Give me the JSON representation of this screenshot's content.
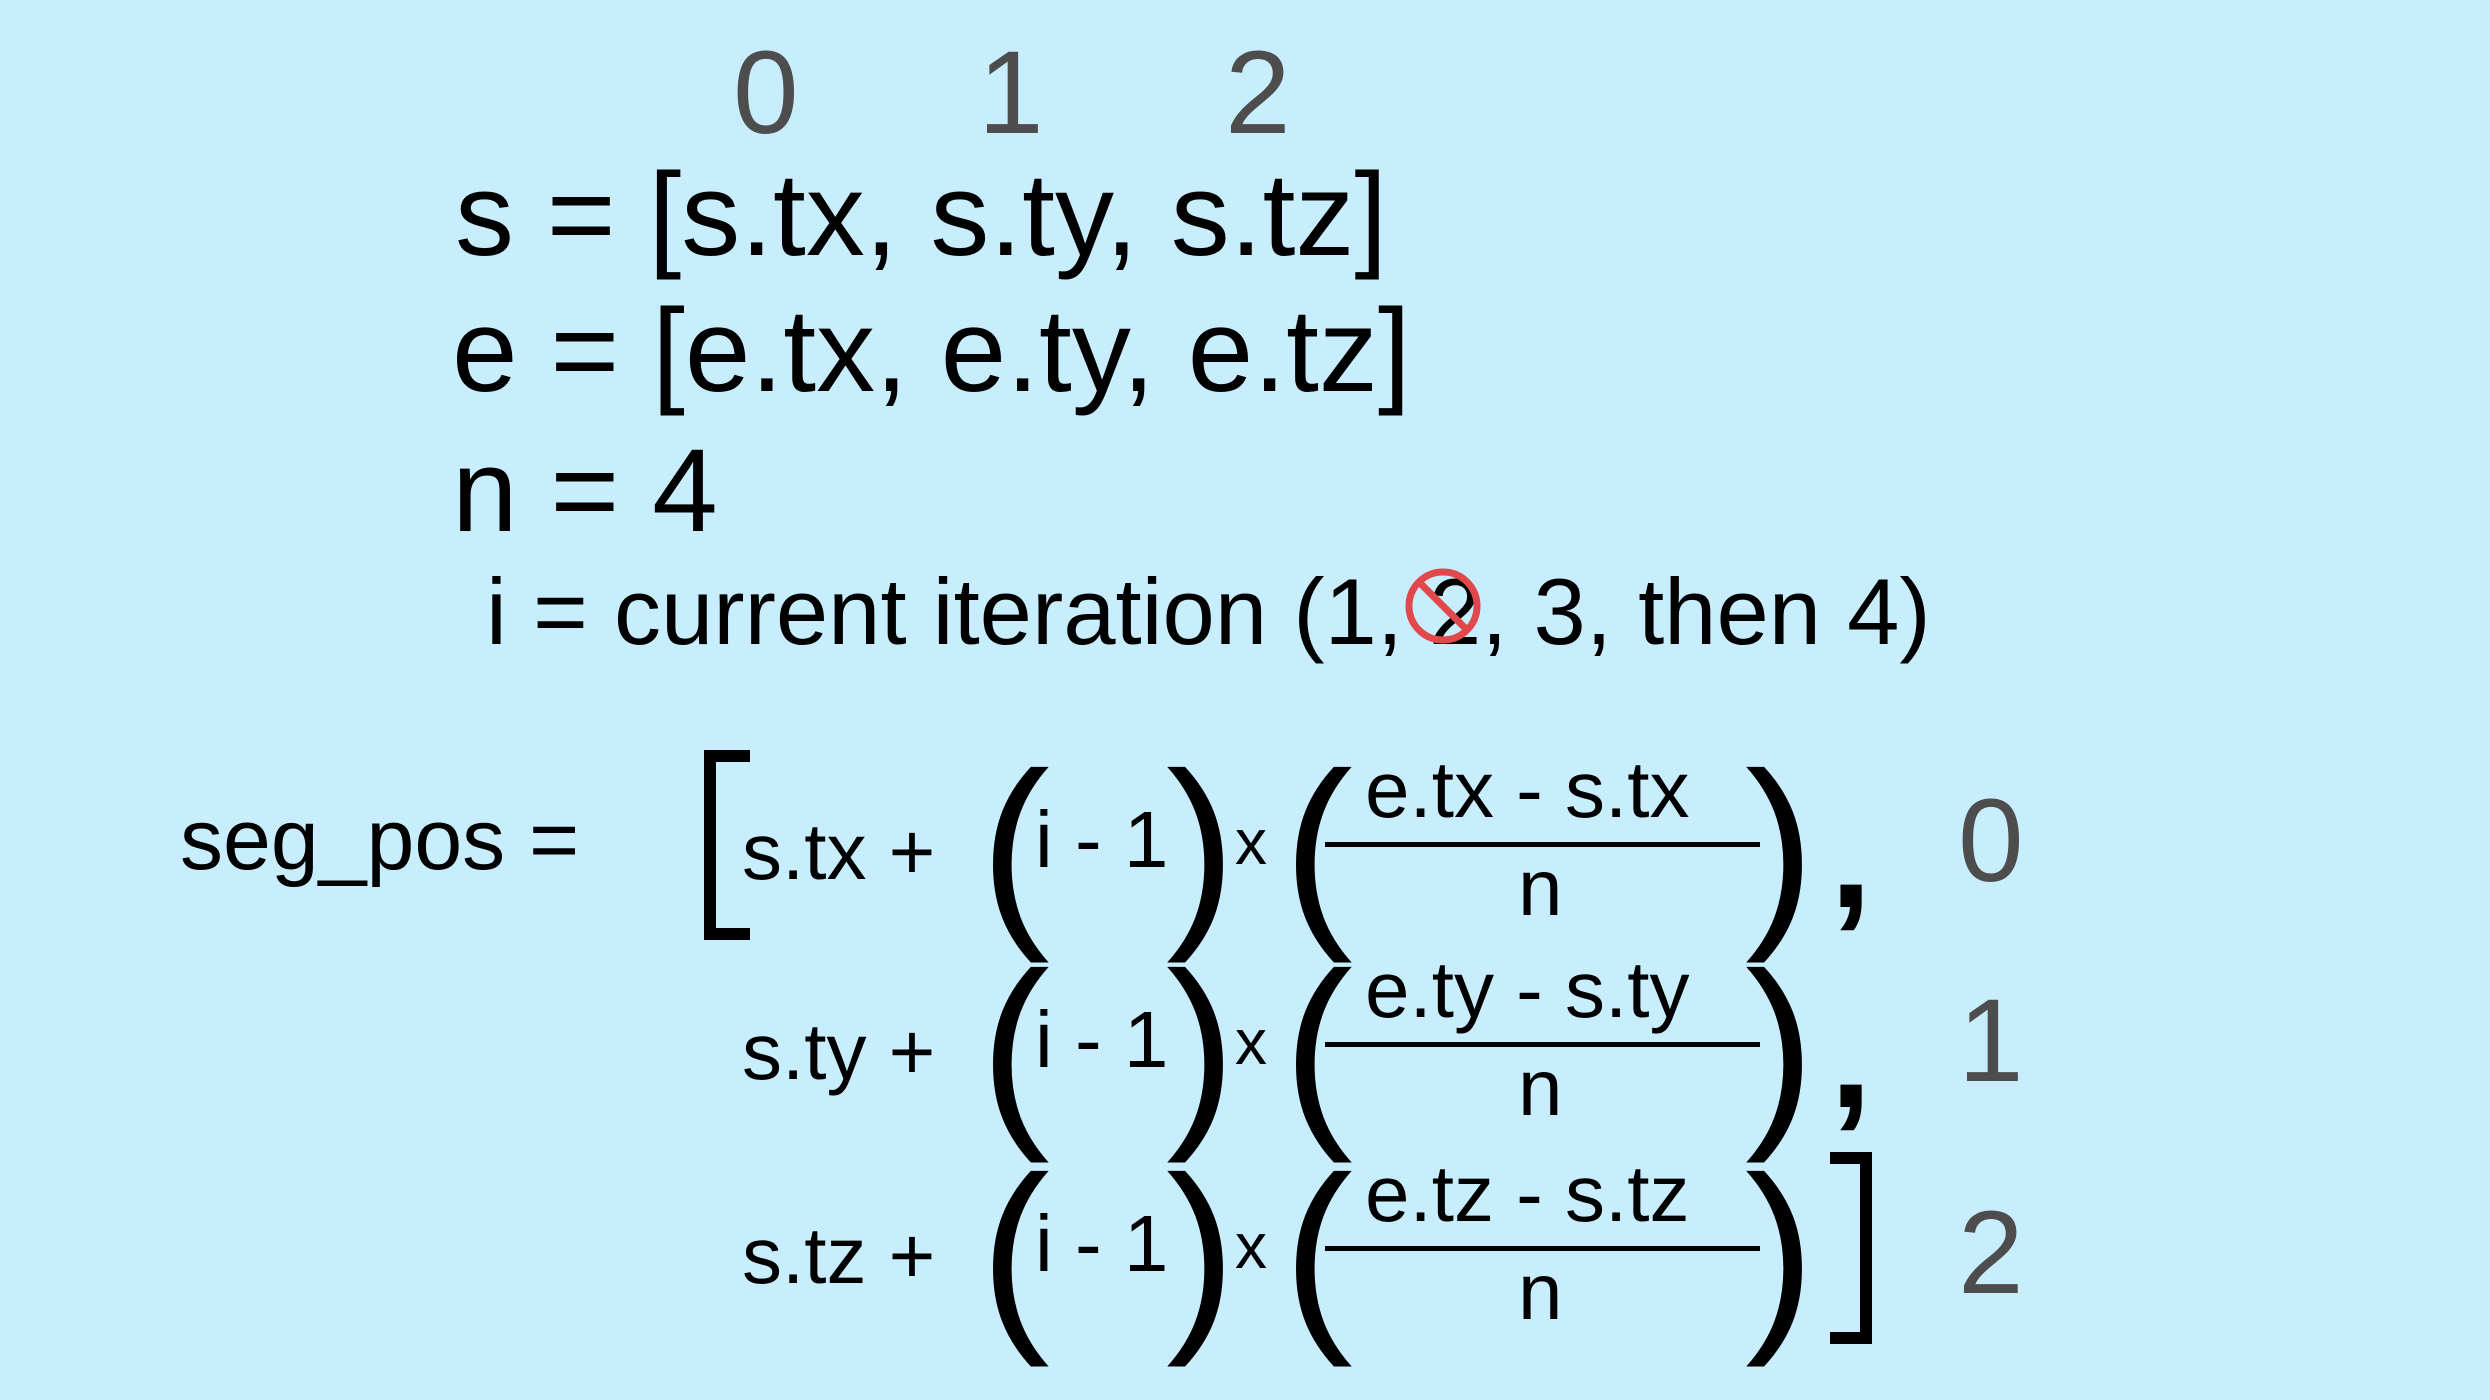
{
  "header_indices": [
    "0",
    "1",
    "2"
  ],
  "definitions": {
    "s_line": "s = [s.tx, s.ty, s.tz]",
    "e_line": "e = [e.tx, e.ty, e.tz]",
    "n_line": "n = 4",
    "i_prefix": "i = current iteration (",
    "i_one": "1",
    "i_suffix": ", 2, 3, then 4)"
  },
  "forbidden_icon_color": "#e0484c",
  "formula": {
    "label": "seg_pos =",
    "rows": [
      {
        "start": "s.tx +",
        "inner": "i - 1",
        "times": "x",
        "numerator": "e.tx - s.tx",
        "denominator": "n",
        "comma": ",",
        "index": "0"
      },
      {
        "start": "s.ty +",
        "inner": "i - 1",
        "times": "x",
        "numerator": "e.ty - s.ty",
        "denominator": "n",
        "comma": ",",
        "index": "1"
      },
      {
        "start": "s.tz +",
        "inner": "i - 1",
        "times": "x",
        "numerator": "e.tz - s.tz",
        "denominator": "n",
        "comma": "",
        "index": "2"
      }
    ]
  }
}
